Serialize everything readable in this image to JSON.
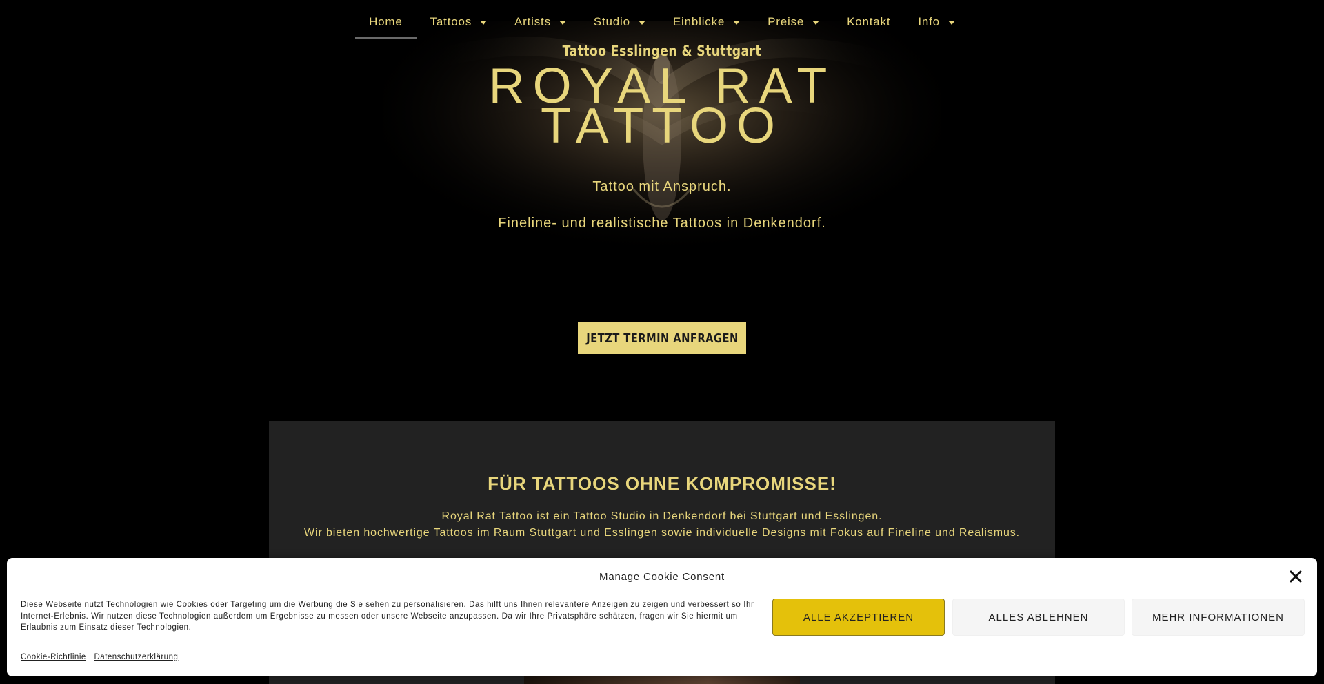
{
  "nav": {
    "items": [
      {
        "label": "Home",
        "dropdown": false,
        "active": true
      },
      {
        "label": "Tattoos",
        "dropdown": true
      },
      {
        "label": "Artists",
        "dropdown": true
      },
      {
        "label": "Studio",
        "dropdown": true
      },
      {
        "label": "Einblicke",
        "dropdown": true
      },
      {
        "label": "Preise",
        "dropdown": true
      },
      {
        "label": "Kontakt",
        "dropdown": false
      },
      {
        "label": "Info",
        "dropdown": true
      }
    ]
  },
  "hero": {
    "subtitle": "Tattoo Esslingen & Stuttgart",
    "title_line1": "ROYAL RAT",
    "title_line2": "TATTOO",
    "tagline": "Tattoo mit Anspruch.",
    "tagline2": "Fineline- und realistische Tattoos in Denkendorf.",
    "cta_label": "JETZT TERMIN ANFRAGEN"
  },
  "section": {
    "heading": "FÜR TATTOOS OHNE KOMPROMISSE!",
    "line1": "Royal Rat Tattoo ist ein Tattoo Studio in Denkendorf bei Stuttgart und Esslingen.",
    "line2_before": "Wir bieten hochwertige ",
    "line2_link": "Tattoos im Raum Stuttgart",
    "line2_after": " und Esslingen sowie individuelle Designs mit Fokus auf Fineline und Realismus."
  },
  "cookie": {
    "title": "Manage Cookie Consent",
    "text": "Diese Webseite nutzt Technologien wie Cookies oder Targeting um die Werbung die Sie sehen zu personalisieren. Das hilft uns Ihnen relevantere Anzeigen zu zeigen und verbessert so Ihr Internet-Erlebnis. Wir nutzen diese Technologien außerdem um Ergebnisse zu messen oder unsere Webseite anzupassen. Da wir Ihre Privatsphäre schätzen, fragen wir Sie hiermit um Erlaubnis zum Einsatz dieser Technologien.",
    "accept_label": "ALLE AKZEPTIEREN",
    "deny_label": "ALLES ABLEHNEN",
    "more_label": "MEHR INFORMATIONEN",
    "link_policy": "Cookie-Richtlinie",
    "link_privacy": "Datenschutzerklärung"
  },
  "colors": {
    "accent": "#e8d67c",
    "accept_button": "#e4c10b",
    "section_bg": "#222222",
    "page_bg": "#000000"
  }
}
